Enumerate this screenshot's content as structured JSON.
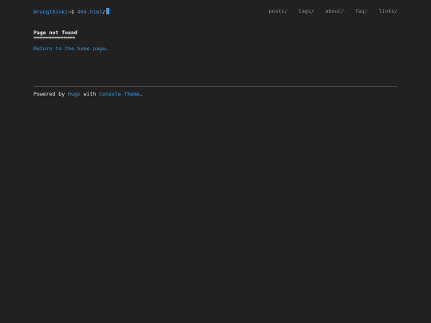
{
  "header": {
    "site_name": "Wrongthink",
    "prompt_symbol": ":~$ ",
    "path": "404.html",
    "path_suffix": "/"
  },
  "nav": {
    "items": [
      {
        "label": "posts/"
      },
      {
        "label": "tags/"
      },
      {
        "label": "about/"
      },
      {
        "label": "faq/"
      },
      {
        "label": "links/"
      }
    ]
  },
  "main": {
    "title": "Page not found",
    "title_underline": "==============",
    "return_link": "Return to the home page",
    "return_suffix": "."
  },
  "footer": {
    "prefix": "Powered by ",
    "hugo_link": "Hugo",
    "middle": " with ",
    "theme_link": "Console Theme",
    "suffix": "."
  },
  "colors": {
    "background": "#212121",
    "accent": "#2f9ee8",
    "text": "#e8e8e8",
    "nav_text": "#8d8d8d",
    "divider": "#4a4a4a"
  }
}
